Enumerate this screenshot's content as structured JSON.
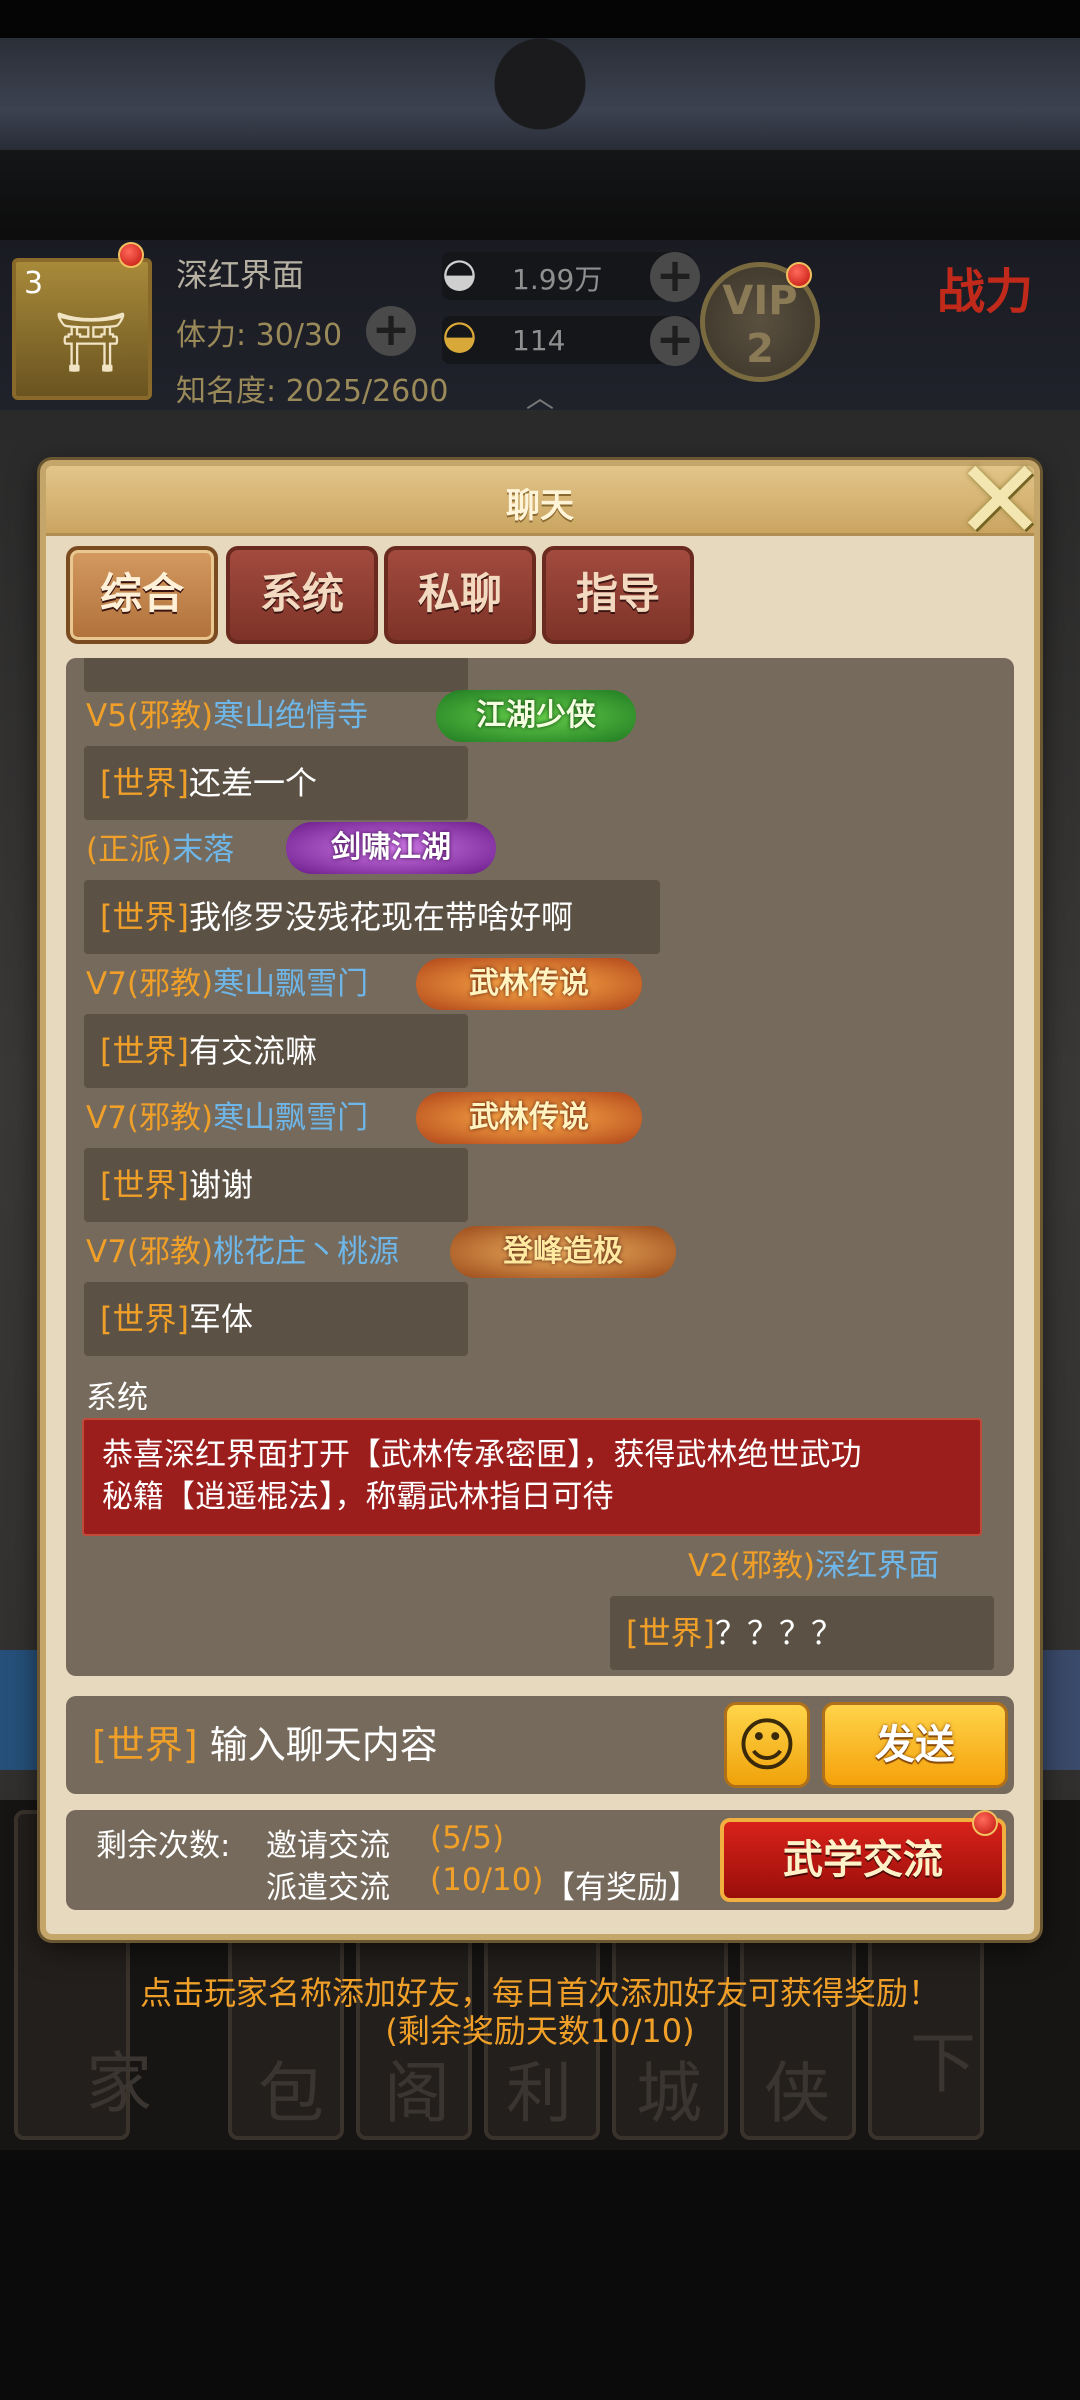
{
  "header": {
    "level": "3",
    "player_name": "深红界面",
    "stamina": "体力: 30/30",
    "fame": "知名度: 2025/2600",
    "silver": "1.99万",
    "gold": "114",
    "vip": "VIP\n2",
    "power": "战力"
  },
  "chat": {
    "title": "聊天",
    "tabs": [
      "综合",
      "系统",
      "私聊",
      "指导"
    ],
    "active_tab": "综合",
    "messages": [
      {
        "tag": "V5(邪教)",
        "name": "寒山绝情寺",
        "badge": "江湖少侠",
        "channel": "[世界]",
        "text": "还差一个"
      },
      {
        "tag": "(正派)",
        "name": "末落",
        "badge": "剑啸江湖",
        "channel": "[世界]",
        "text": "我修罗没残花现在带啥好啊"
      },
      {
        "tag": "V7(邪教)",
        "name": "寒山飘雪门",
        "badge": "武林传说",
        "channel": "[世界]",
        "text": "有交流嘛"
      },
      {
        "tag": "V7(邪教)",
        "name": "寒山飘雪门",
        "badge": "武林传说",
        "channel": "[世界]",
        "text": "谢谢"
      },
      {
        "tag": "V7(邪教)",
        "name": "桃花庄丶桃源",
        "badge": "登峰造极",
        "channel": "[世界]",
        "text": "军体"
      }
    ],
    "system": {
      "label": "系统",
      "line1": "恭喜深红界面打开【武林传承密匣】，获得武林绝世武功",
      "line2": "秘籍【逍遥棍法】，称霸武林指日可待"
    },
    "own_message": {
      "tag": "V2(邪教)",
      "name": "深红界面",
      "channel": "[世界]",
      "text": "？？？？"
    },
    "input": {
      "channel": "[世界]",
      "placeholder": "输入聊天内容"
    },
    "send_label": "发送",
    "emoji_icon": "smiley-icon"
  },
  "exchange": {
    "label": "剩余次数:",
    "invite_label": "邀请交流",
    "invite_count": "(5/5)",
    "dispatch_label": "派遣交流",
    "dispatch_count": "(10/10)",
    "reward_note": "【有奖励】",
    "button": "武学交流"
  },
  "hint": {
    "line1": "点击玩家名称添加好友，每日首次添加好友可获得奖励！",
    "line2": "(剩余奖励天数10/10)"
  },
  "menu_chars": [
    "家",
    "包",
    "阁",
    "利",
    "城",
    "侠",
    "下"
  ],
  "colors": {
    "channel": "#f0a028",
    "name": "#6fb6e8",
    "panel": "#e6d9bd",
    "chat_bg": "#756a5c",
    "system_bg": "#9b1d1c"
  }
}
